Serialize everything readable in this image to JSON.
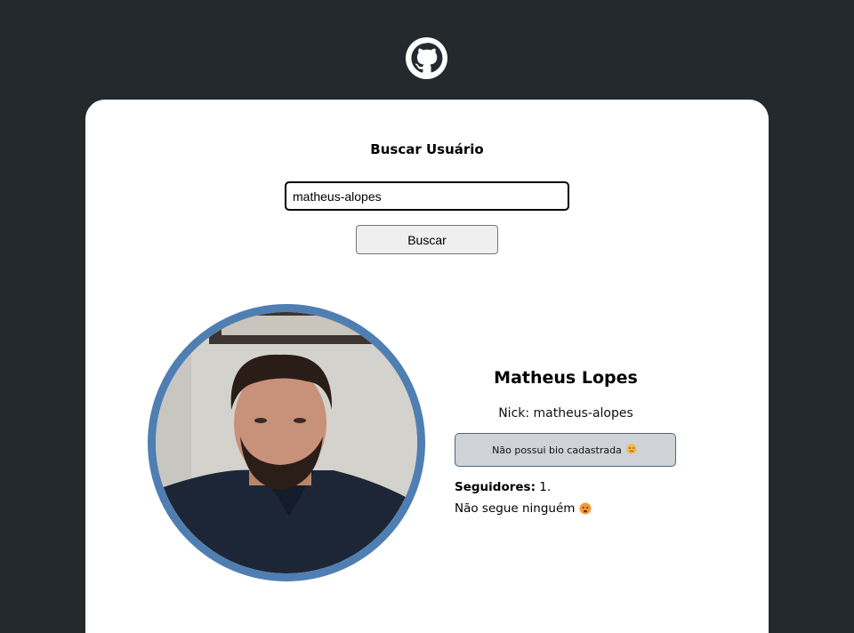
{
  "header": {
    "logo_icon": "github-octocat-icon"
  },
  "search": {
    "title": "Buscar Usuário",
    "input_value": "matheus-alopes",
    "button_label": "Buscar"
  },
  "profile": {
    "avatar_icon": "user-avatar-photo",
    "name": "Matheus Lopes",
    "nick": "Nick: matheus-alopes",
    "bio": "Não possui bio cadastrada",
    "followers_label": "Seguidores:",
    "followers_value": "1.",
    "following_text": "Não segue ninguém"
  },
  "colors": {
    "background": "#24292e",
    "card": "#ffffff",
    "avatar_border": "#4f7fb2",
    "bio_background": "#cfd2d6"
  }
}
